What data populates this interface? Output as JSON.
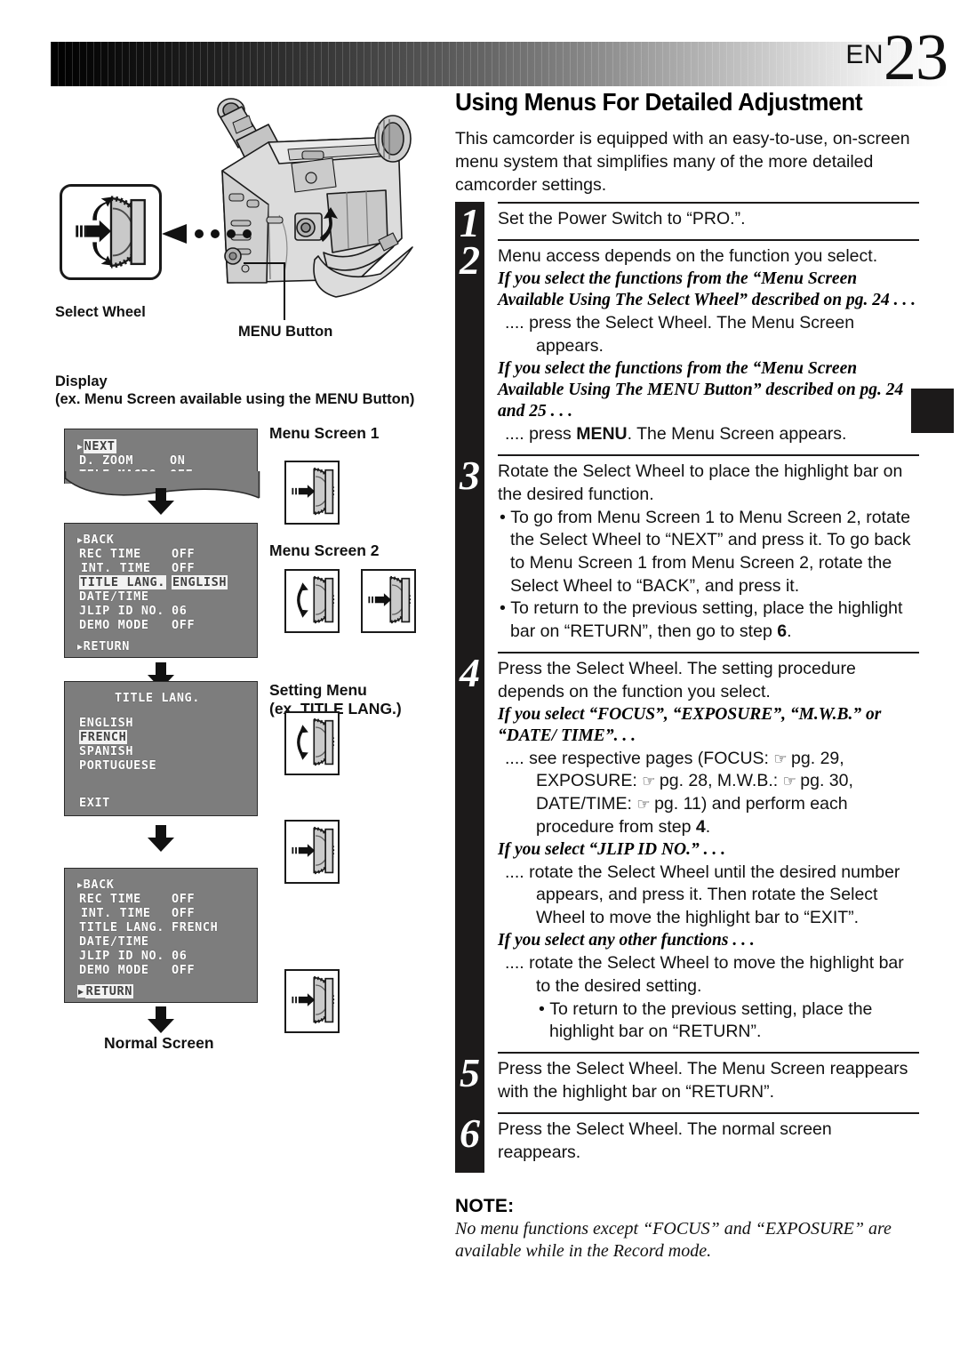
{
  "header": {
    "lang_code": "EN",
    "page_number": "23"
  },
  "main": {
    "title": "Using Menus For Detailed Adjustment",
    "intro": "This camcorder is equipped with an easy-to-use, on-screen menu system that simplifies many of the more detailed camcorder settings.",
    "steps": [
      {
        "number": "1",
        "text": "Set the Power Switch to “PRO.”."
      },
      {
        "number": "2",
        "text": "Menu access depends on the function you select.",
        "case1_heading": "If you select the functions from the “Menu Screen Available Using The Select Wheel” described on pg. 24 . . .",
        "case1_body": ".... press the Select Wheel. The Menu Screen",
        "case1_body2": "appears.",
        "case2_heading": "If you select the functions from the “Menu Screen Available Using The MENU Button” described on pg. 24 and 25 . . .",
        "case2_body_pre": ".... press ",
        "case2_body_bold": "MENU",
        "case2_body_post": ". The Menu Screen appears."
      },
      {
        "number": "3",
        "text": "Rotate the Select Wheel to place the highlight bar on the desired function.",
        "bullet1": "To go from Menu Screen 1 to Menu Screen 2, rotate the Select Wheel to “NEXT” and press it. To go back to Menu Screen 1 from Menu Screen 2, rotate the Select Wheel to “BACK”, and press it.",
        "bullet2_pre": "To return to the previous setting, place the highlight bar on “RETURN”, then go to step ",
        "bullet2_step": "6",
        "bullet2_post": "."
      },
      {
        "number": "4",
        "text": "Press the Select Wheel. The setting procedure depends on the function you select.",
        "case1_heading": "If you select “FOCUS”, “EXPOSURE”, “M.W.B.” or “DATE/ TIME”. . .",
        "case1_body_l1": ".... see respective pages (FOCUS: ",
        "case1_pg1": "pg. 29,",
        "case1_body_l2": "EXPOSURE: ",
        "case1_pg2": "pg. 28, M.W.B.: ",
        "case1_pg3": "pg. 30,",
        "case1_body_l3": "DATE/TIME: ",
        "case1_pg4": "pg. 11) and perform each",
        "case1_body_l4_pre": "procedure from step ",
        "case1_body_l4_bold": "4",
        "case1_body_l4_post": ".",
        "case2_heading": "If you select “JLIP ID NO.” . . .",
        "case2_body_l1": ".... rotate the Select Wheel until the desired number",
        "case2_body_l2": "appears, and press it. Then rotate the Select",
        "case2_body_l3": "Wheel to move the highlight bar to “EXIT”.",
        "case3_heading": "If you select any other functions . . .",
        "case3_body_l1": ".... rotate the Select Wheel to move the highlight bar",
        "case3_body_l2": "to the desired setting.",
        "case3_bullet": "To return to the previous setting, place the highlight bar on “RETURN”."
      },
      {
        "number": "5",
        "text": "Press the Select Wheel. The Menu Screen reappears with the highlight bar on “RETURN”."
      },
      {
        "number": "6",
        "text": "Press the Select Wheel. The normal screen reappears."
      }
    ],
    "note": {
      "title": "NOTE:",
      "text": "No menu functions except “FOCUS” and “EXPOSURE” are available while in the Record mode."
    }
  },
  "illustration": {
    "select_wheel_label": "Select Wheel",
    "menu_button_label": "MENU Button",
    "display_label": "Display",
    "display_sub_label": "(ex. Menu Screen available using the MENU Button)",
    "normal_screen_label": "Normal Screen",
    "menu_screen_1_label": "Menu Screen 1",
    "menu_screen_2_label": "Menu Screen 2",
    "setting_menu_label": "Setting Menu",
    "setting_menu_sub_label": "(ex. TITLE LANG.)"
  },
  "osd_screens": {
    "screen1": {
      "rows": [
        {
          "label": "NEXT",
          "value": "",
          "marker": "▸",
          "highlight": true
        },
        {
          "label": "D. ZOOM",
          "value": "ON",
          "marker": "",
          "highlight": false
        },
        {
          "label": "TELE MACRO",
          "value": "OFF",
          "marker": "",
          "highlight": false
        }
      ]
    },
    "screen2": {
      "rows": [
        {
          "label": "BACK",
          "value": "",
          "marker": "▸",
          "highlight": false
        },
        {
          "label": "REC TIME",
          "value": "OFF",
          "marker": "",
          "highlight": false
        },
        {
          "label": "INT. TIME",
          "value": "OFF",
          "marker": "",
          "highlight": false
        },
        {
          "label": "TITLE LANG.",
          "value": "ENGLISH",
          "marker": "",
          "highlight": true
        },
        {
          "label": "DATE/TIME",
          "value": "",
          "marker": "",
          "highlight": false
        },
        {
          "label": "JLIP ID NO.",
          "value": "06",
          "marker": "",
          "highlight": false
        },
        {
          "label": "DEMO MODE",
          "value": "OFF",
          "marker": "",
          "highlight": false
        },
        {
          "label": "RETURN",
          "value": "",
          "marker": "▸",
          "highlight": false
        }
      ]
    },
    "screen3": {
      "title": "TITLE LANG.",
      "rows": [
        {
          "label": "ENGLISH",
          "highlight": false
        },
        {
          "label": "FRENCH",
          "highlight": true
        },
        {
          "label": "SPANISH",
          "highlight": false
        },
        {
          "label": "PORTUGUESE",
          "highlight": false
        },
        {
          "label": "EXIT",
          "highlight": false
        }
      ]
    },
    "screen4": {
      "rows": [
        {
          "label": "BACK",
          "value": "",
          "marker": "▸",
          "highlight": false
        },
        {
          "label": "REC TIME",
          "value": "OFF",
          "marker": "",
          "highlight": false
        },
        {
          "label": "INT. TIME",
          "value": "OFF",
          "marker": "",
          "highlight": false
        },
        {
          "label": "TITLE LANG.",
          "value": "FRENCH",
          "marker": "",
          "highlight": false
        },
        {
          "label": "DATE/TIME",
          "value": "",
          "marker": "",
          "highlight": false
        },
        {
          "label": "JLIP ID NO.",
          "value": "06",
          "marker": "",
          "highlight": false
        },
        {
          "label": "DEMO MODE",
          "value": "OFF",
          "marker": "",
          "highlight": false
        },
        {
          "label": "RETURN",
          "value": "",
          "marker": "▸",
          "highlight": true
        }
      ]
    }
  },
  "colors": {
    "osd_background": "#7d7d7d",
    "osd_text": "#ffffff",
    "highlight_background": "#f2f2f2",
    "highlight_text": "#3f3f3f",
    "step_block": "#1c1a1a"
  }
}
